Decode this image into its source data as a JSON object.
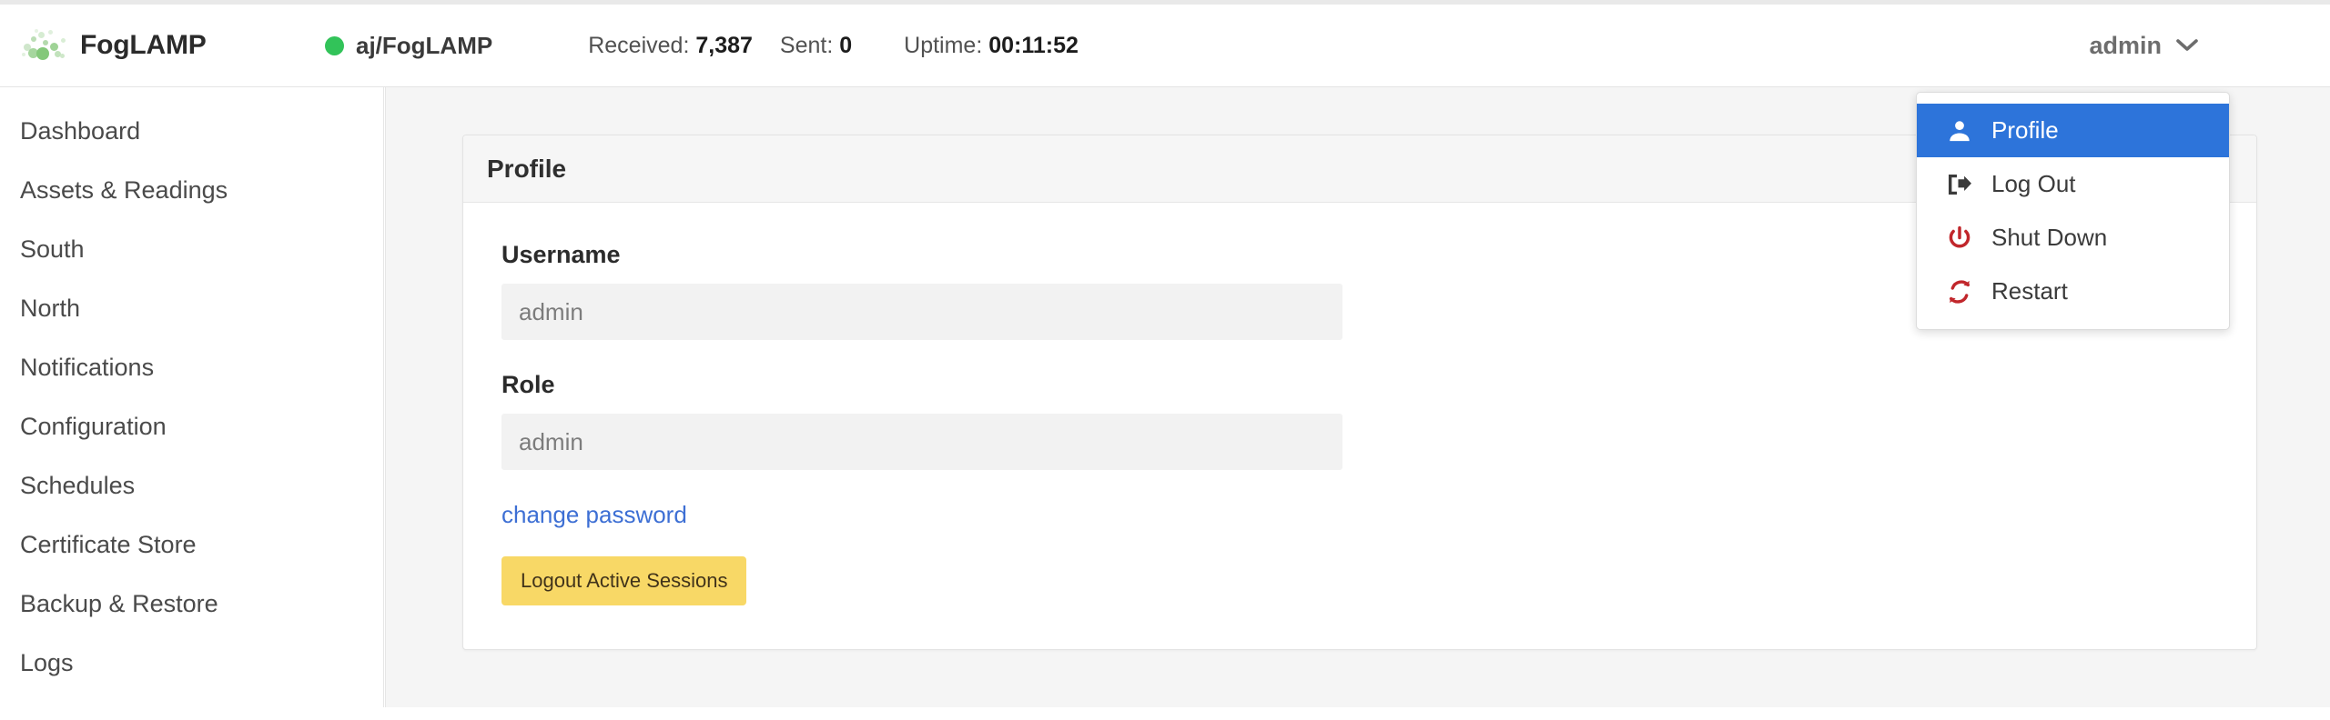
{
  "header": {
    "brand_name": "FogLAMP",
    "logo_icon": "dot-cluster-logo",
    "connection": {
      "status_icon": "green-status-dot",
      "label": "aj/FogLAMP",
      "status_color": "#32c359"
    },
    "stats": [
      {
        "key": "Received:",
        "value": "7,387"
      },
      {
        "key": "Sent:",
        "value": "0"
      },
      {
        "key": "Uptime:",
        "value": "00:11:52"
      }
    ],
    "user": {
      "name": "admin",
      "caret_icon": "chevron-down-icon"
    }
  },
  "sidebar": {
    "items": [
      {
        "label": "Dashboard"
      },
      {
        "label": "Assets & Readings"
      },
      {
        "label": "South"
      },
      {
        "label": "North"
      },
      {
        "label": "Notifications"
      },
      {
        "label": "Configuration"
      },
      {
        "label": "Schedules"
      },
      {
        "label": "Certificate Store"
      },
      {
        "label": "Backup & Restore"
      },
      {
        "label": "Logs"
      }
    ]
  },
  "dropdown": {
    "items": [
      {
        "label": "Profile",
        "icon": "user-icon",
        "active": true
      },
      {
        "label": "Log Out",
        "icon": "sign-out-icon",
        "active": false
      },
      {
        "label": "Shut Down",
        "icon": "power-off-icon",
        "active": false
      },
      {
        "label": "Restart",
        "icon": "refresh-icon",
        "active": false
      }
    ],
    "active_color": "#2d74da",
    "danger_color": "#c1262b"
  },
  "main": {
    "card_title": "Profile",
    "username": {
      "label": "Username",
      "value": "admin",
      "placeholder": "admin"
    },
    "role": {
      "label": "Role",
      "value": "admin",
      "placeholder": "admin"
    },
    "change_password_link": "change password",
    "logout_sessions_button": "Logout Active Sessions",
    "button_color": "#f8d866",
    "link_color": "#3d6fd4"
  }
}
